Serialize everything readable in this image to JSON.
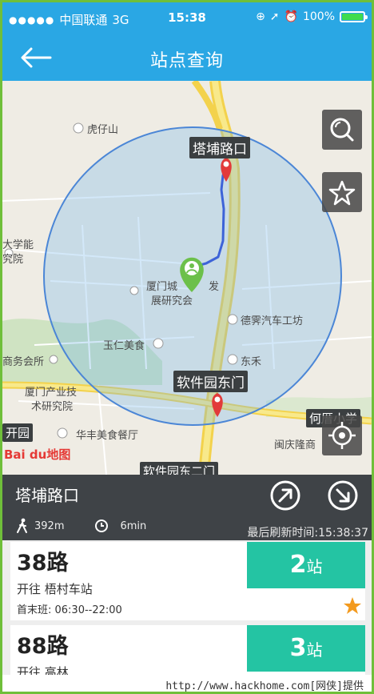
{
  "status": {
    "carrier": "中国联通",
    "network": "3G",
    "time": "15:38",
    "battery": "100%"
  },
  "nav": {
    "title": "站点查询"
  },
  "map": {
    "labels": {
      "huzishan": "虎仔山",
      "daxueneng": "大学能",
      "jiuyuan": "究院",
      "xiamen_cheng": "厦门城",
      "yan": "发",
      "zhanyanjiu": "展研究会",
      "derun": "德霁汽车工坊",
      "yuren": "玉仁美食",
      "donghe": "东禾",
      "shanghui": "商务会所",
      "xiamenchanye": "厦门产业技",
      "shuyanjiu": "术研究院",
      "huafeng": "华丰美食餐厅",
      "kaiyuan": "开园",
      "minqing": "闽庆隆商",
      "hexia": "何厝小学",
      "bottom_road": "软件园东二门"
    },
    "stops": {
      "top": "塔埔路口",
      "bottom": "软件园东门"
    },
    "baidu_logo": "Bai du地图"
  },
  "station": {
    "name": "塔埔路口",
    "distance": "392m",
    "duration": "6min",
    "refresh": "最后刷新时间:15:38:37"
  },
  "routes": [
    {
      "name": "38路",
      "direction": "开往 梧村车站",
      "hours": "首末班: 06:30--22:00",
      "stops_num": "2",
      "stops_unit": "站"
    },
    {
      "name": "88路",
      "direction": "开往 高林",
      "stops_num": "3",
      "stops_unit": "站"
    }
  ],
  "watermark": "http://www.hackhome.com[网侠]提供",
  "colors": {
    "brand_blue": "#2aa7e4",
    "teal": "#24c4a3",
    "panel_dark": "#3f4347",
    "star_orange": "#f39a1e"
  }
}
